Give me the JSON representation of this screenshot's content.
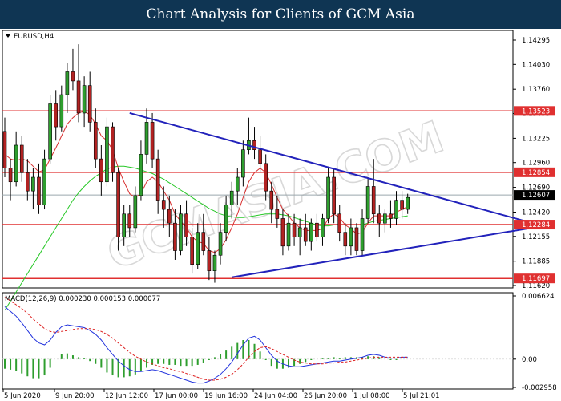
{
  "page_title": "Chart Analysis for Clients of GCM Asia",
  "watermark": "GCMASIA.COM",
  "colors": {
    "banner": "#0f3553",
    "bull": "#2e9e2e",
    "bear": "#b22222",
    "resistance_support": "#e03030",
    "trendline": "#2222bb",
    "ma_fast": "#d83030",
    "ma_slow": "#28c828",
    "macd_line": "#2233dd",
    "macd_signal": "#dd2222"
  },
  "chart_data": {
    "type": "candlestick",
    "symbol_label": "EURUSD,H4",
    "ylim": [
      1.1162,
      1.14295
    ],
    "price_ticks": [
      "1.14295",
      "1.14030",
      "1.13760",
      "1.13495",
      "1.13225",
      "1.12960",
      "1.12690",
      "1.12420",
      "1.12155",
      "1.11885",
      "1.11620"
    ],
    "x_ticks": [
      "5 Jun 2020",
      "9 Jun 20:00",
      "12 Jun 12:00",
      "17 Jun 00:00",
      "19 Jun 16:00",
      "24 Jun 04:00",
      "26 Jun 20:00",
      "1 Jul 08:00",
      "5 Jul 21:01"
    ],
    "current_price": "1.12607",
    "horizontal_levels": [
      "1.13523",
      "1.12854",
      "1.12284",
      "1.11697"
    ],
    "trendlines": [
      {
        "name": "upper",
        "from": [
          22,
          1.135
        ],
        "to": [
          96,
          1.1225
        ]
      },
      {
        "name": "lower",
        "from": [
          40,
          1.1171
        ],
        "to": [
          96,
          1.1228
        ]
      }
    ],
    "candles": [
      [
        1.133,
        1.1345,
        1.128,
        1.129
      ],
      [
        1.129,
        1.13,
        1.1255,
        1.1275
      ],
      [
        1.1275,
        1.133,
        1.127,
        1.1315
      ],
      [
        1.1315,
        1.1325,
        1.1275,
        1.1285
      ],
      [
        1.1285,
        1.13,
        1.1255,
        1.1265
      ],
      [
        1.1265,
        1.129,
        1.1245,
        1.128
      ],
      [
        1.128,
        1.1295,
        1.124,
        1.125
      ],
      [
        1.125,
        1.131,
        1.1245,
        1.13
      ],
      [
        1.13,
        1.137,
        1.1295,
        1.136
      ],
      [
        1.136,
        1.1375,
        1.132,
        1.1335
      ],
      [
        1.1335,
        1.138,
        1.133,
        1.137
      ],
      [
        1.137,
        1.1405,
        1.135,
        1.1395
      ],
      [
        1.1395,
        1.142,
        1.1375,
        1.1385
      ],
      [
        1.1385,
        1.1425,
        1.134,
        1.135
      ],
      [
        1.135,
        1.139,
        1.1335,
        1.138
      ],
      [
        1.138,
        1.1395,
        1.133,
        1.134
      ],
      [
        1.134,
        1.1355,
        1.129,
        1.13
      ],
      [
        1.13,
        1.1315,
        1.126,
        1.1275
      ],
      [
        1.1275,
        1.1345,
        1.127,
        1.1335
      ],
      [
        1.1335,
        1.134,
        1.1275,
        1.1285
      ],
      [
        1.1285,
        1.129,
        1.12,
        1.1215
      ],
      [
        1.1215,
        1.125,
        1.1205,
        1.124
      ],
      [
        1.124,
        1.125,
        1.1215,
        1.1225
      ],
      [
        1.1225,
        1.127,
        1.122,
        1.126
      ],
      [
        1.126,
        1.132,
        1.1255,
        1.1305
      ],
      [
        1.1305,
        1.1355,
        1.1295,
        1.134
      ],
      [
        1.134,
        1.135,
        1.129,
        1.13
      ],
      [
        1.13,
        1.131,
        1.124,
        1.1255
      ],
      [
        1.1255,
        1.127,
        1.1225,
        1.1245
      ],
      [
        1.1245,
        1.126,
        1.1215,
        1.123
      ],
      [
        1.123,
        1.1245,
        1.119,
        1.12
      ],
      [
        1.12,
        1.125,
        1.1195,
        1.124
      ],
      [
        1.124,
        1.1255,
        1.1205,
        1.1215
      ],
      [
        1.1215,
        1.1225,
        1.1175,
        1.1185
      ],
      [
        1.1185,
        1.123,
        1.118,
        1.122
      ],
      [
        1.122,
        1.124,
        1.1195,
        1.12
      ],
      [
        1.12,
        1.1215,
        1.1168,
        1.1178
      ],
      [
        1.1178,
        1.12,
        1.1165,
        1.1195
      ],
      [
        1.1195,
        1.123,
        1.1185,
        1.122
      ],
      [
        1.122,
        1.126,
        1.121,
        1.125
      ],
      [
        1.125,
        1.1275,
        1.1235,
        1.1265
      ],
      [
        1.1265,
        1.129,
        1.125,
        1.128
      ],
      [
        1.128,
        1.132,
        1.127,
        1.131
      ],
      [
        1.131,
        1.1345,
        1.1305,
        1.132
      ],
      [
        1.132,
        1.1335,
        1.13,
        1.131
      ],
      [
        1.131,
        1.1325,
        1.1285,
        1.1295
      ],
      [
        1.1295,
        1.1305,
        1.1255,
        1.1265
      ],
      [
        1.1265,
        1.1275,
        1.123,
        1.1245
      ],
      [
        1.1245,
        1.126,
        1.1225,
        1.1235
      ],
      [
        1.1235,
        1.1245,
        1.1195,
        1.1205
      ],
      [
        1.1205,
        1.124,
        1.12,
        1.123
      ],
      [
        1.123,
        1.124,
        1.1205,
        1.1215
      ],
      [
        1.1215,
        1.1235,
        1.1195,
        1.1225
      ],
      [
        1.1225,
        1.124,
        1.1205,
        1.121
      ],
      [
        1.121,
        1.1235,
        1.12,
        1.123
      ],
      [
        1.123,
        1.124,
        1.121,
        1.1215
      ],
      [
        1.1215,
        1.124,
        1.1205,
        1.1235
      ],
      [
        1.1235,
        1.129,
        1.123,
        1.128
      ],
      [
        1.128,
        1.129,
        1.123,
        1.124
      ],
      [
        1.124,
        1.125,
        1.121,
        1.122
      ],
      [
        1.122,
        1.123,
        1.1195,
        1.1205
      ],
      [
        1.1205,
        1.1235,
        1.1195,
        1.1225
      ],
      [
        1.1225,
        1.123,
        1.1195,
        1.12
      ],
      [
        1.12,
        1.1245,
        1.1195,
        1.1235
      ],
      [
        1.1235,
        1.128,
        1.123,
        1.127
      ],
      [
        1.127,
        1.13,
        1.123,
        1.124
      ],
      [
        1.124,
        1.125,
        1.1215,
        1.123
      ],
      [
        1.123,
        1.1245,
        1.122,
        1.124
      ],
      [
        1.124,
        1.1255,
        1.1225,
        1.1235
      ],
      [
        1.1235,
        1.1265,
        1.1228,
        1.1255
      ],
      [
        1.1255,
        1.1265,
        1.1235,
        1.1245
      ],
      [
        1.1245,
        1.1262,
        1.124,
        1.1258
      ]
    ],
    "ma_fast": [
      1.1305,
      1.13,
      1.1298,
      1.13,
      1.1298,
      1.1292,
      1.1286,
      1.1288,
      1.13,
      1.1312,
      1.1325,
      1.1338,
      1.1345,
      1.135,
      1.1352,
      1.1348,
      1.1338,
      1.1325,
      1.132,
      1.131,
      1.129,
      1.1275,
      1.1262,
      1.1258,
      1.1262,
      1.1275,
      1.128,
      1.1275,
      1.1265,
      1.1255,
      1.124,
      1.1232,
      1.1225,
      1.1215,
      1.121,
      1.1208,
      1.12,
      1.1198,
      1.1202,
      1.1212,
      1.1225,
      1.124,
      1.1258,
      1.1275,
      1.1285,
      1.129,
      1.1285,
      1.1272,
      1.1258,
      1.1245,
      1.1238,
      1.123,
      1.1225,
      1.1222,
      1.1222,
      1.1222,
      1.1224,
      1.1235,
      1.124,
      1.1236,
      1.1228,
      1.1224,
      1.1218,
      1.122,
      1.123,
      1.1238,
      1.1238,
      1.1238,
      1.1238,
      1.1242,
      1.1245,
      1.1248
    ],
    "ma_slow": [
      1.1135,
      1.1145,
      1.1155,
      1.1165,
      1.1175,
      1.1185,
      1.1195,
      1.1205,
      1.1215,
      1.1225,
      1.1235,
      1.1245,
      1.1255,
      1.1263,
      1.127,
      1.1276,
      1.1281,
      1.1285,
      1.1289,
      1.1291,
      1.1292,
      1.1292,
      1.1291,
      1.129,
      1.1288,
      1.1286,
      1.1284,
      1.1281,
      1.1278,
      1.1274,
      1.127,
      1.1266,
      1.1262,
      1.1258,
      1.1254,
      1.125,
      1.1246,
      1.1243,
      1.124,
      1.1238,
      1.1237,
      1.1236,
      1.1236,
      1.1237,
      1.1238,
      1.1239,
      1.124,
      1.124,
      1.124,
      1.1239,
      1.1238,
      1.1236,
      1.1234,
      1.1232,
      1.123,
      1.1228,
      1.1227,
      1.1227,
      1.1228,
      1.1228,
      1.1228,
      1.1228,
      1.1228,
      1.1228,
      1.123,
      1.1232,
      1.1233,
      1.1234,
      1.1235,
      1.1236,
      1.1237,
      1.1238
    ],
    "macd": {
      "label": "MACD(12,26,9) 0.000230 0.000153 0.000077",
      "ylim": [
        -0.002958,
        0.006624
      ],
      "ticks": [
        "0.006624",
        "0.00",
        "-0.002958"
      ],
      "line": [
        0.0055,
        0.005,
        0.0045,
        0.0038,
        0.003,
        0.0022,
        0.0017,
        0.0015,
        0.002,
        0.0028,
        0.0034,
        0.0036,
        0.0035,
        0.0034,
        0.0033,
        0.003,
        0.0026,
        0.002,
        0.0012,
        0.0005,
        -0.0002,
        -0.0007,
        -0.0011,
        -0.0013,
        -0.0013,
        -0.0012,
        -0.0011,
        -0.0012,
        -0.0014,
        -0.0016,
        -0.0018,
        -0.002,
        -0.0022,
        -0.0024,
        -0.0025,
        -0.0025,
        -0.0023,
        -0.002,
        -0.0016,
        -0.001,
        -0.0003,
        0.0006,
        0.0015,
        0.0022,
        0.0024,
        0.002,
        0.0012,
        0.0004,
        -0.0002,
        -0.0005,
        -0.0007,
        -0.0008,
        -0.0008,
        -0.0007,
        -0.0006,
        -0.0005,
        -0.0004,
        -0.0003,
        -0.0002,
        -0.0002,
        -0.0001,
        0.0,
        0.0001,
        0.0002,
        0.0004,
        0.0005,
        0.0004,
        0.0002,
        0.0001,
        0.0001,
        0.0002,
        0.0002
      ],
      "signal": [
        0.0065,
        0.0061,
        0.0057,
        0.0053,
        0.0048,
        0.0042,
        0.0037,
        0.0032,
        0.0029,
        0.0028,
        0.0029,
        0.003,
        0.0031,
        0.0032,
        0.0032,
        0.0032,
        0.0031,
        0.0029,
        0.0026,
        0.0022,
        0.0017,
        0.0012,
        0.0007,
        0.0003,
        0.0,
        -0.0003,
        -0.0005,
        -0.0007,
        -0.0009,
        -0.001,
        -0.0012,
        -0.0013,
        -0.0015,
        -0.0017,
        -0.0019,
        -0.0021,
        -0.0022,
        -0.0022,
        -0.0021,
        -0.0019,
        -0.0016,
        -0.0011,
        -0.0005,
        0.0002,
        0.0008,
        0.0012,
        0.0013,
        0.0011,
        0.0008,
        0.0005,
        0.0002,
        -0.0001,
        -0.0003,
        -0.0004,
        -0.0005,
        -0.0005,
        -0.0005,
        -0.0004,
        -0.0004,
        -0.0003,
        -0.0003,
        -0.0002,
        -0.0001,
        0.0,
        0.0001,
        0.0002,
        0.0002,
        0.0002,
        0.0002,
        0.0002,
        0.0002,
        0.0002
      ]
    }
  }
}
